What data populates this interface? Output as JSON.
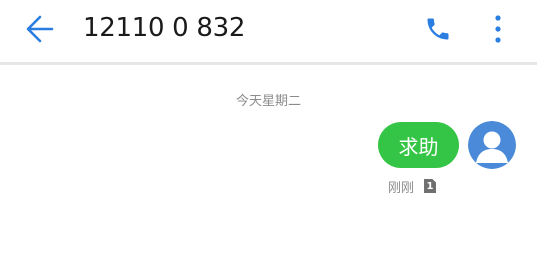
{
  "header": {
    "title": "12110 0 832",
    "icons": {
      "back": "arrow-left-icon",
      "call": "phone-icon",
      "more": "more-vertical-icon"
    },
    "accent_color": "#2a7de1"
  },
  "conversation": {
    "date_separator": "今天星期二",
    "messages": [
      {
        "text": "求助",
        "direction": "outgoing",
        "bubble_color": "#35c546",
        "time": "刚刚",
        "sim": "1",
        "avatar_icon": "user-avatar-icon"
      }
    ]
  }
}
